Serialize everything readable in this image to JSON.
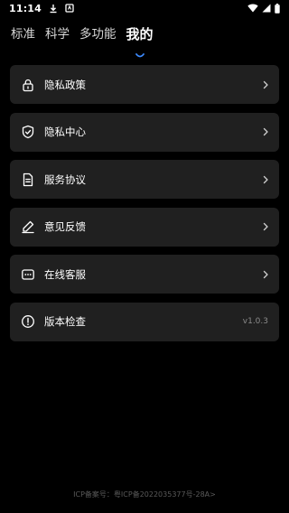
{
  "status_bar": {
    "time": "11:14"
  },
  "tabs": [
    {
      "label": "标准"
    },
    {
      "label": "科学"
    },
    {
      "label": "多功能"
    },
    {
      "label": "我的",
      "active": true
    }
  ],
  "menu": [
    {
      "label": "隐私政策",
      "icon": "lock-icon"
    },
    {
      "label": "隐私中心",
      "icon": "shield-check-icon"
    },
    {
      "label": "服务协议",
      "icon": "document-icon"
    },
    {
      "label": "意见反馈",
      "icon": "pencil-icon"
    },
    {
      "label": "在线客服",
      "icon": "chat-icon"
    },
    {
      "label": "版本检查",
      "icon": "info-icon",
      "value": "v1.0.3"
    }
  ],
  "footer": {
    "text": "ICP备案号：粤ICP备2022035377号-28A>"
  }
}
